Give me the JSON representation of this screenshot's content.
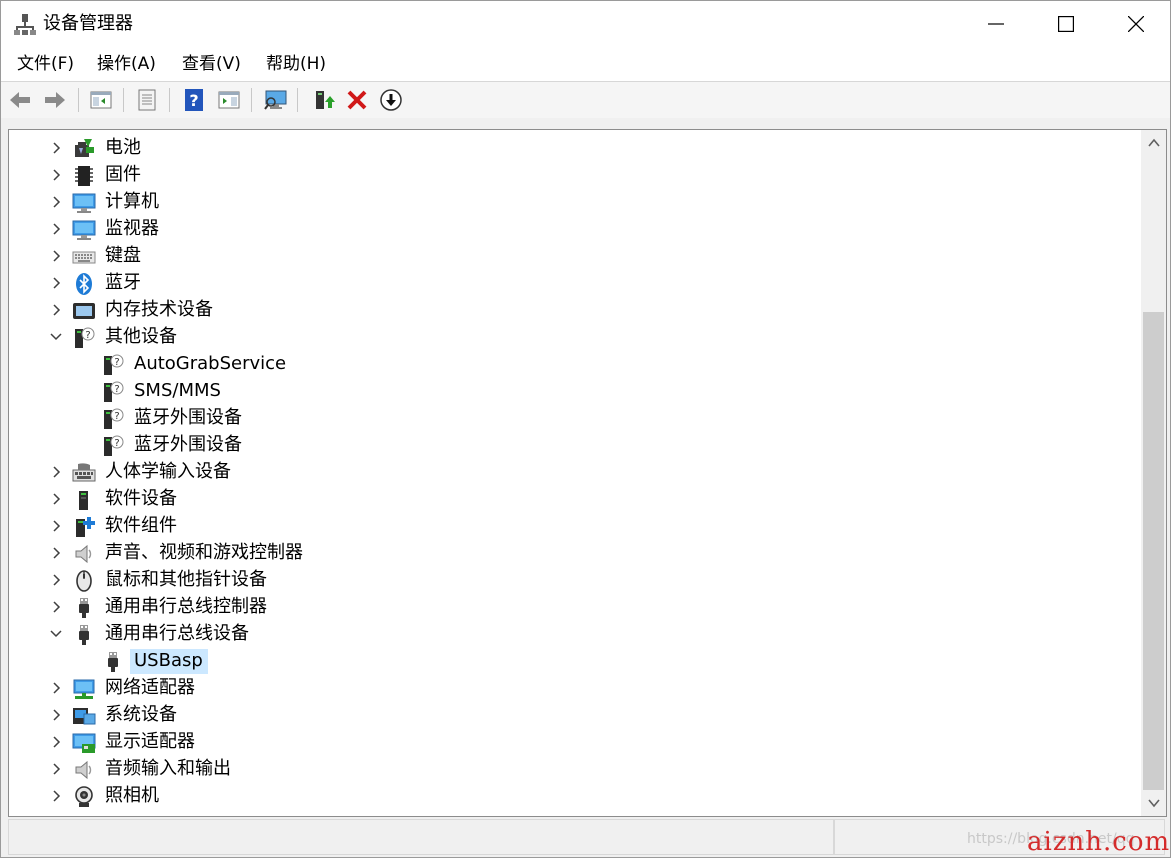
{
  "window": {
    "title": "设备管理器"
  },
  "menu": [
    {
      "label": "文件(F)"
    },
    {
      "label": "操作(A)"
    },
    {
      "label": "查看(V)"
    },
    {
      "label": "帮助(H)"
    }
  ],
  "toolbar": {
    "buttons": [
      "back-icon",
      "forward-icon",
      "show-hide-console-tree-icon",
      "properties-icon",
      "help-icon",
      "action-pane-icon",
      "scan-hardware-icon",
      "update-driver-icon",
      "uninstall-icon",
      "disable-device-icon"
    ]
  },
  "tree": [
    {
      "label": "电池",
      "icon": "battery-icon",
      "expanded": false
    },
    {
      "label": "固件",
      "icon": "firmware-icon",
      "expanded": false
    },
    {
      "label": "计算机",
      "icon": "computer-icon",
      "expanded": false
    },
    {
      "label": "监视器",
      "icon": "monitor-icon",
      "expanded": false
    },
    {
      "label": "键盘",
      "icon": "keyboard-icon",
      "expanded": false
    },
    {
      "label": "蓝牙",
      "icon": "bluetooth-icon",
      "expanded": false
    },
    {
      "label": "内存技术设备",
      "icon": "memory-device-icon",
      "expanded": false
    },
    {
      "label": "其他设备",
      "icon": "unknown-device-icon",
      "expanded": true
    },
    {
      "label": "AutoGrabService",
      "icon": "unknown-device-icon",
      "child": true
    },
    {
      "label": "SMS/MMS",
      "icon": "unknown-device-icon",
      "child": true
    },
    {
      "label": "蓝牙外围设备",
      "icon": "unknown-device-icon",
      "child": true
    },
    {
      "label": "蓝牙外围设备",
      "icon": "unknown-device-icon",
      "child": true
    },
    {
      "label": "人体学输入设备",
      "icon": "hid-icon",
      "expanded": false
    },
    {
      "label": "软件设备",
      "icon": "software-device-icon",
      "expanded": false
    },
    {
      "label": "软件组件",
      "icon": "software-component-icon",
      "expanded": false
    },
    {
      "label": "声音、视频和游戏控制器",
      "icon": "sound-icon",
      "expanded": false
    },
    {
      "label": "鼠标和其他指针设备",
      "icon": "mouse-icon",
      "expanded": false
    },
    {
      "label": "通用串行总线控制器",
      "icon": "usb-icon",
      "expanded": false
    },
    {
      "label": "通用串行总线设备",
      "icon": "usb-icon",
      "expanded": true
    },
    {
      "label": "USBasp",
      "icon": "usb-icon",
      "child": true,
      "selected": true
    },
    {
      "label": "网络适配器",
      "icon": "network-adapter-icon",
      "expanded": false
    },
    {
      "label": "系统设备",
      "icon": "system-device-icon",
      "expanded": false
    },
    {
      "label": "显示适配器",
      "icon": "display-adapter-icon",
      "expanded": false
    },
    {
      "label": "音频输入和输出",
      "icon": "audio-io-icon",
      "expanded": false
    },
    {
      "label": "照相机",
      "icon": "camera-icon",
      "expanded": false
    }
  ],
  "watermark": {
    "url": "https://blog.csdn.net/qq",
    "brand": "aiznh.com"
  },
  "colors": {
    "selection": "#cce8ff",
    "accent_blue": "#2b7bd4",
    "delete_red": "#d01818"
  }
}
